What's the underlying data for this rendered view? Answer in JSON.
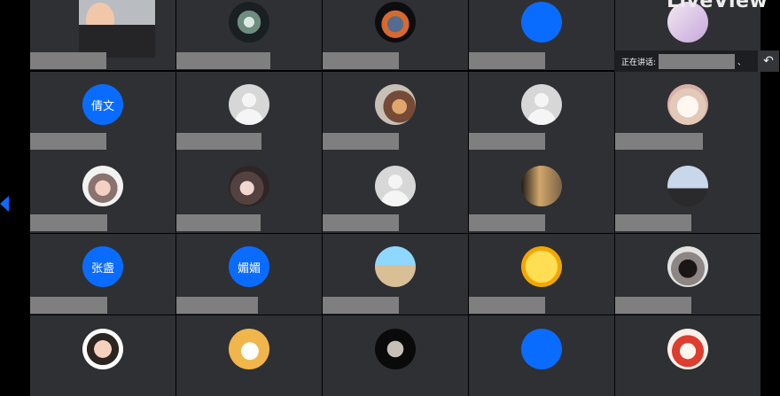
{
  "speaker": {
    "label": "正在讲话:",
    "tail": "、"
  },
  "brand": {
    "text": "LiveView"
  },
  "tiles": [
    {
      "type": "webcam"
    },
    {
      "type": "photo",
      "avatar_class": "photo-2"
    },
    {
      "type": "photo",
      "avatar_class": "photo-3"
    },
    {
      "type": "color",
      "avatar_class": "blue",
      "label": ""
    },
    {
      "type": "photo",
      "avatar_class": "photo-4"
    },
    {
      "type": "color",
      "avatar_class": "blue",
      "label": "倩文"
    },
    {
      "type": "default"
    },
    {
      "type": "photo",
      "avatar_class": "photo-5"
    },
    {
      "type": "default"
    },
    {
      "type": "photo",
      "avatar_class": "photo-6"
    },
    {
      "type": "photo",
      "avatar_class": "photo-7"
    },
    {
      "type": "photo",
      "avatar_class": "photo-8"
    },
    {
      "type": "default"
    },
    {
      "type": "photo",
      "avatar_class": "photo-9"
    },
    {
      "type": "photo",
      "avatar_class": "photo-10"
    },
    {
      "type": "color",
      "avatar_class": "blue",
      "label": "张盏"
    },
    {
      "type": "color",
      "avatar_class": "blue",
      "label": "媚媚"
    },
    {
      "type": "photo",
      "avatar_class": "photo-11"
    },
    {
      "type": "photo",
      "avatar_class": "photo-12"
    },
    {
      "type": "photo",
      "avatar_class": "photo-13"
    },
    {
      "type": "photo",
      "avatar_class": "photo-14"
    },
    {
      "type": "photo",
      "avatar_class": "photo-15"
    },
    {
      "type": "photo",
      "avatar_class": "photo-16"
    },
    {
      "type": "color",
      "avatar_class": "blue",
      "label": ""
    },
    {
      "type": "photo",
      "avatar_class": "photo-17"
    }
  ],
  "colors": {
    "tile": "#2f3033",
    "blue": "#0a6cff",
    "name_mask": "#7f7f7f"
  }
}
